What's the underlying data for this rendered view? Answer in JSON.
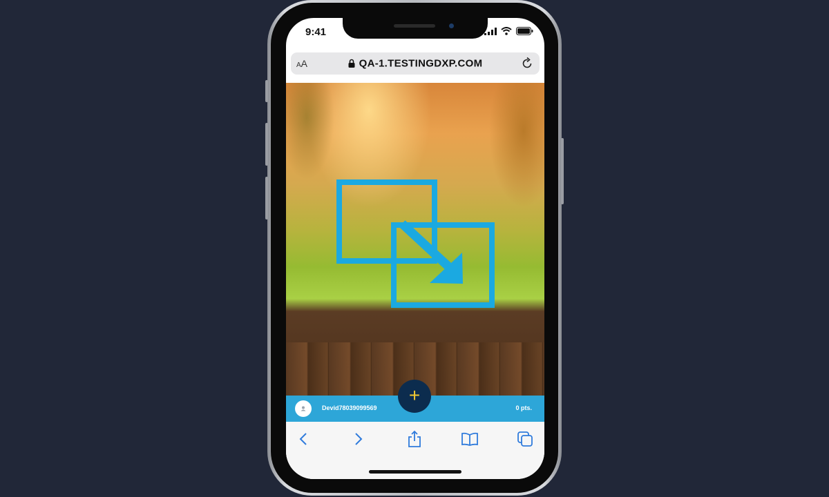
{
  "status_bar": {
    "time": "9:41",
    "icons": [
      "signal-icon",
      "wifi-icon",
      "battery-icon"
    ]
  },
  "browser": {
    "text_size_label": "AA",
    "url": "QA-1.TESTINGDXP.COM",
    "icons": [
      "lock-icon",
      "reload-icon"
    ]
  },
  "hero": {
    "icon": "minimize-window-arrow-icon",
    "accent_color": "#1ba9e1"
  },
  "user_bar": {
    "username": "Devid78039099569",
    "points": "0 pts.",
    "color": "#2da6d8"
  },
  "fab": {
    "label": "+",
    "color": "#0c2c4e",
    "glyph_color": "#f0c832"
  },
  "toolbar": {
    "items": [
      "back-icon",
      "forward-icon",
      "share-icon",
      "bookmarks-icon",
      "tabs-icon"
    ],
    "accent_color": "#2f7bdc"
  }
}
